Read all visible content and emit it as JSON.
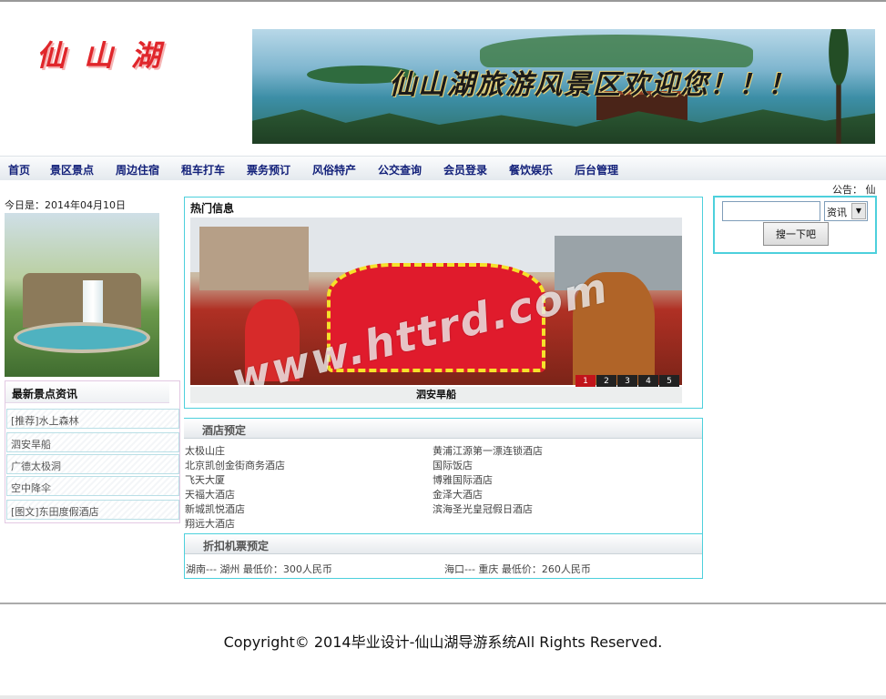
{
  "header": {
    "logo_text": "仙山湖",
    "banner_text": "仙山湖旅游风景区欢迎您！！！"
  },
  "nav": {
    "items": [
      "首页",
      "景区景点",
      "周边住宿",
      "租车打车",
      "票务预订",
      "风俗特产",
      "公交查询",
      "会员登录",
      "餐饮娱乐",
      "后台管理"
    ]
  },
  "notice": {
    "label": "公告：",
    "text": "仙"
  },
  "left": {
    "today": "今日是：2014年04月10日",
    "news_title": "最新景点资讯",
    "news": [
      "[推荐]水上森林",
      "泗安旱船",
      "广德太极洞",
      "空中降伞",
      "[图文]东田度假酒店"
    ]
  },
  "hot": {
    "title": "热门信息",
    "watermark": "www.httrd.com",
    "pages": [
      "1",
      "2",
      "3",
      "4",
      "5"
    ],
    "active_page": 1,
    "caption": "泗安旱船"
  },
  "hotel": {
    "title": "酒店预定",
    "col1": [
      "太极山庄",
      "北京凯创金街商务酒店",
      "飞天大厦",
      "天福大酒店",
      "新城凯悦酒店",
      "翔远大酒店"
    ],
    "col2": [
      "黄浦江源第一漂连锁酒店",
      "国际饭店",
      "博雅国际酒店",
      "金泽大酒店",
      "滨海圣光皇冠假日酒店"
    ]
  },
  "ticket": {
    "title": "折扣机票预定",
    "row1": "湖南--- 湖州  最低价：300人民币",
    "row2": "海口--- 重庆  最低价：260人民币"
  },
  "search": {
    "input_value": "",
    "select_value": "资讯",
    "button_label": "搜一下吧"
  },
  "footer": {
    "copyright": "Copyright© 2014毕业设计-仙山湖导游系统All Rights Reserved."
  },
  "colors": {
    "nav_text": "#13217a",
    "border_accent": "#4dd0dc",
    "logo_red": "#e0262b"
  }
}
